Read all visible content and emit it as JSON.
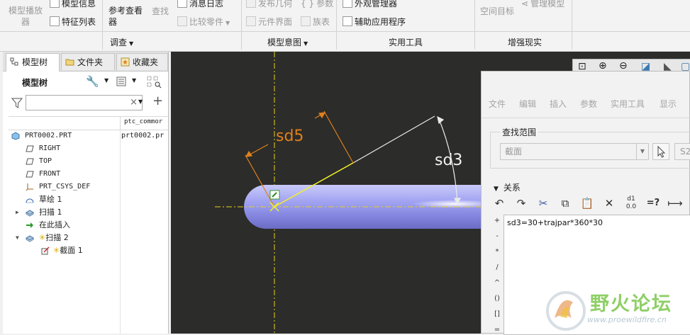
{
  "ribbon": {
    "groups": [
      {
        "label": "调查"
      },
      {
        "label": "模型意图"
      },
      {
        "label": "实用工具"
      },
      {
        "label": "增强现实"
      }
    ],
    "buttons": {
      "model_playback": "模型播放\n器",
      "model_info": "模型信息",
      "feature_list": "特征列表",
      "ref_viewer": "参考查看\n器",
      "find": "查找",
      "message_log": "消息日志",
      "compare_part": "比较零件",
      "publish_geom": "发布几何",
      "params": "参数",
      "component_interface": "元件界面",
      "family_table": "族表",
      "appearance_manager": "外观管理器",
      "aux_apps": "辅助应用程序",
      "space_target": "空间目标",
      "manage_model": "管理模型"
    }
  },
  "left_panel": {
    "tabs": [
      {
        "label": "模型树"
      },
      {
        "label": "文件夹"
      },
      {
        "label": "收藏夹"
      }
    ],
    "header_title": "模型树",
    "column_header": "ptc_commor",
    "tree": [
      {
        "label": "PRT0002.PRT",
        "value": "prt0002.pr",
        "icon": "part-icon"
      },
      {
        "label": "RIGHT",
        "icon": "datum-plane-icon"
      },
      {
        "label": "TOP",
        "icon": "datum-plane-icon"
      },
      {
        "label": "FRONT",
        "icon": "datum-plane-icon"
      },
      {
        "label": "PRT_CSYS_DEF",
        "icon": "csys-icon"
      },
      {
        "label": "草绘 1",
        "icon": "sketch-icon"
      },
      {
        "label": "扫描 1",
        "icon": "sweep-icon"
      },
      {
        "label": "在此插入",
        "icon": "insert-arrow-icon"
      },
      {
        "label": "扫描 2",
        "icon": "sweep-icon"
      },
      {
        "label": "截面 1",
        "icon": "section-icon"
      }
    ]
  },
  "graphics": {
    "dim_sd5": "sd5",
    "dim_sd3": "sd3"
  },
  "dialog": {
    "menus": [
      {
        "label": "文件"
      },
      {
        "label": "编辑"
      },
      {
        "label": "插入"
      },
      {
        "label": "参数"
      },
      {
        "label": "实用工具"
      },
      {
        "label": "显示"
      }
    ],
    "scope_label": "查找范围",
    "scope_value": "截面",
    "scope_id": "S2",
    "relations_label": "关系",
    "operators": [
      "+",
      "-",
      "*",
      "/",
      "^",
      "()",
      "[]",
      "="
    ],
    "relation_text": "sd3=30+trajpar*360*30"
  },
  "watermark": {
    "title": "野火论坛",
    "url": "www.proewildfire.cn"
  },
  "colors": {
    "graphics_bg": "#2c2c2a",
    "dim_orange": "#e0801c",
    "axis_yellow": "#e8d020",
    "sweep_lavender": "#9a9cf0"
  }
}
